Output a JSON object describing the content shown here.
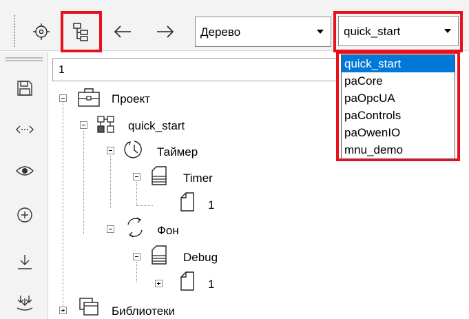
{
  "view_combo": {
    "value": "Дерево"
  },
  "project_combo": {
    "value": "quick_start"
  },
  "project_list": [
    "quick_start",
    "paCore",
    "paOpcUA",
    "paControls",
    "paOwenIO",
    "mnu_demo"
  ],
  "tree_header": "1",
  "tree": {
    "project": "Проект",
    "quick_start": "quick_start",
    "timer": "Таймер",
    "timer_child": "Timer",
    "timer_page": "1",
    "background": "Фон",
    "debug": "Debug",
    "debug_page": "1",
    "libraries": "Библиотеки"
  },
  "colors": {
    "highlight": "#e8101d",
    "selection": "#0078d7"
  }
}
